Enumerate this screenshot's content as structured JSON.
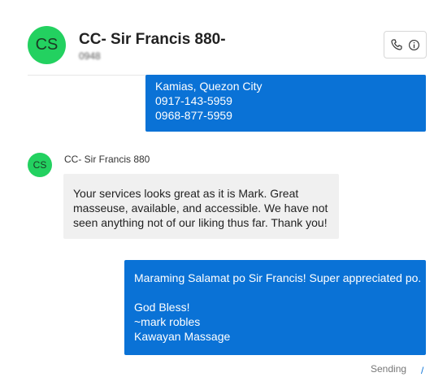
{
  "header": {
    "avatar_initials": "CS",
    "contact_name": "CC- Sir Francis 880-",
    "contact_sub": "0948",
    "call_icon": "phone-icon",
    "info_icon": "info-icon"
  },
  "previous_message": {
    "lines": [
      "Kamias, Quezon City",
      "0917-143-5959",
      "0968-877-5959"
    ]
  },
  "incoming": {
    "avatar_initials": "CS",
    "sender_name": "CC- Sir Francis 880",
    "text": "Your services looks great as it is Mark. Great masseuse, available, and accessible. We have not seen anything not of our liking thus far. Thank you!"
  },
  "outgoing": {
    "lines": [
      "Maraming Salamat po Sir Francis! Super appreciated po.",
      "",
      "God Bless!",
      "~mark robles",
      "Kawayan Massage"
    ]
  },
  "status": {
    "text": "Sending",
    "mark": "/"
  },
  "colors": {
    "accent": "#0a72d6",
    "avatar": "#23d160",
    "incoming_bg": "#f0f0f0"
  }
}
